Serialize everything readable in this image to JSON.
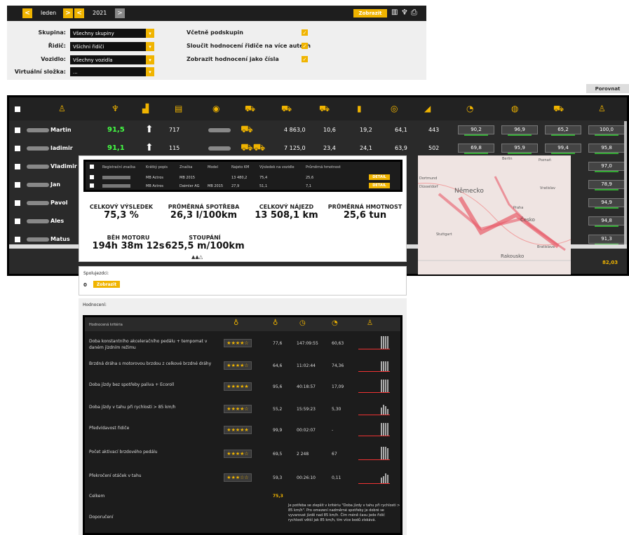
{
  "topbar": {
    "month": "leden",
    "year": "2021",
    "show_button": "Zobrazit"
  },
  "filters": {
    "group_label": "Skupina:",
    "group_value": "Všechny skupiny",
    "driver_label": "Řidič:",
    "driver_value": "Všichni řidiči",
    "vehicle_label": "Vozidlo:",
    "vehicle_value": "Všechny vozidla",
    "vfolder_label": "Virtuální složka:",
    "vfolder_value": "...",
    "subgroups_label": "Včetně podskupin",
    "merge_label": "Sloučit hodnocení řidiče na více autech",
    "numbers_label": "Zobrazit hodnocení jako čísla"
  },
  "compare_button": "Porovnat",
  "grid": {
    "rows": [
      {
        "name": "Martin",
        "score": "91,5",
        "n": "717",
        "km": "4 863,0",
        "c1": "10,6",
        "c2": "19,2",
        "c3": "64,1",
        "c4": "443",
        "s": [
          "90,2",
          "96,9",
          "65,2",
          "100,0"
        ]
      },
      {
        "name": "ladimir",
        "score": "91,1",
        "n": "115",
        "km": "7 125,0",
        "c1": "23,4",
        "c2": "24,1",
        "c3": "63,9",
        "c4": "502",
        "s": [
          "69,8",
          "95,9",
          "99,4",
          "95,8"
        ]
      },
      {
        "name": "Vladimir",
        "s4": "97,0"
      },
      {
        "name": "Jan",
        "s4": "78,9"
      },
      {
        "name": "Pavol",
        "s4": "94,9"
      },
      {
        "name": "Ales",
        "s4": "94,8"
      },
      {
        "name": "Matus",
        "s4": "91,3"
      }
    ],
    "footer_value": "82,03"
  },
  "vehicles": {
    "headers": [
      "Registrační značka",
      "Krátký popis",
      "Značka",
      "Model",
      "Najeto KM",
      "Výsledek na vozidle",
      "Průměrná hmotnost"
    ],
    "rows": [
      {
        "desc": "MB Actros",
        "brand": "MB 2015",
        "model": "",
        "km": "13 480,2",
        "result": "75,4",
        "weight": "25,6"
      },
      {
        "desc": "MB Actros",
        "brand": "Daimler AG",
        "model": "MB 2015",
        "km": "27,9",
        "result": "51,1",
        "weight": "7,1"
      }
    ],
    "detail_label": "DETAIL"
  },
  "stats": [
    {
      "label": "CELKOVÝ VÝSLEDEK",
      "value": "75,3 %"
    },
    {
      "label": "PRŮMĚRNÁ SPOTŘEBA",
      "value": "26,3 l/100km"
    },
    {
      "label": "CELKOVÝ NÁJEZD",
      "value": "13 508,1 km"
    },
    {
      "label": "PRŮMĚRNÁ HMOTNOST",
      "value": "25,6 tun"
    },
    {
      "label": "BĚH MOTORU",
      "value": "194h 38m 12s"
    },
    {
      "label": "STOUPÁNÍ",
      "value": "625,5 m/100km"
    }
  ],
  "spolujezdci": {
    "label": "Spolujezdci:",
    "count": "0",
    "button": "Zobrazit"
  },
  "hodnoceni": {
    "label": "Hodnocení:",
    "header": "Hodnocená kritéria",
    "rows": [
      {
        "name": "Doba konstantního akceleračního pedálu + tempomat v daném jízdním režimu",
        "stars": "★★★★☆",
        "v1": "77,6",
        "v2": "147:09:55",
        "v3": "60,63"
      },
      {
        "name": "Brzdná dráha s motorovou brzdou z celkové brzdné dráhy",
        "stars": "★★★★☆",
        "v1": "64,6",
        "v2": "11:02:44",
        "v3": "74,36"
      },
      {
        "name": "Doba jízdy bez spotřeby paliva + Ecoroll",
        "stars": "★★★★★",
        "v1": "95,6",
        "v2": "40:18:57",
        "v3": "17,09"
      },
      {
        "name": "Doba jízdy v tahu při rychlosti > 85 km/h",
        "stars": "★★★★☆",
        "v1": "55,2",
        "v2": "15:59:23",
        "v3": "5,30"
      },
      {
        "name": "Předvídavost řidiče",
        "stars": "★★★★★",
        "v1": "99,9",
        "v2": "00:02:07",
        "v3": "-"
      },
      {
        "name": "Počet aktivací brzdového pedálu",
        "stars": "★★★★☆",
        "v1": "69,5",
        "v2": "2 248",
        "v3": "67"
      },
      {
        "name": "Překročení otáček v tahu",
        "stars": "★★★☆☆",
        "v1": "59,3",
        "v2": "00:26:10",
        "v3": "0,11"
      }
    ],
    "total_label": "Celkem",
    "total_value": "75,3",
    "recommend_label": "Doporučení",
    "recommend_text": "Je potřeba se zlepšit v kritériu \"Doba jízdy v tahu při rychlosti > 85 km/h\". Pro omezení nadměrné spotřeby je dobré se vyvarovat jízdě nad 85 km/h. Čím méně času jede řidič rychlostí větší jak 85 km/h, tím více bodů získává."
  },
  "map": {
    "labels": [
      "Německo",
      "Česko",
      "Rakousko",
      "Praha",
      "Berlin",
      "Bratislava",
      "Dortmund",
      "Düsseldorf",
      "Stuttgart",
      "Poznaň",
      "Vratislav"
    ]
  }
}
